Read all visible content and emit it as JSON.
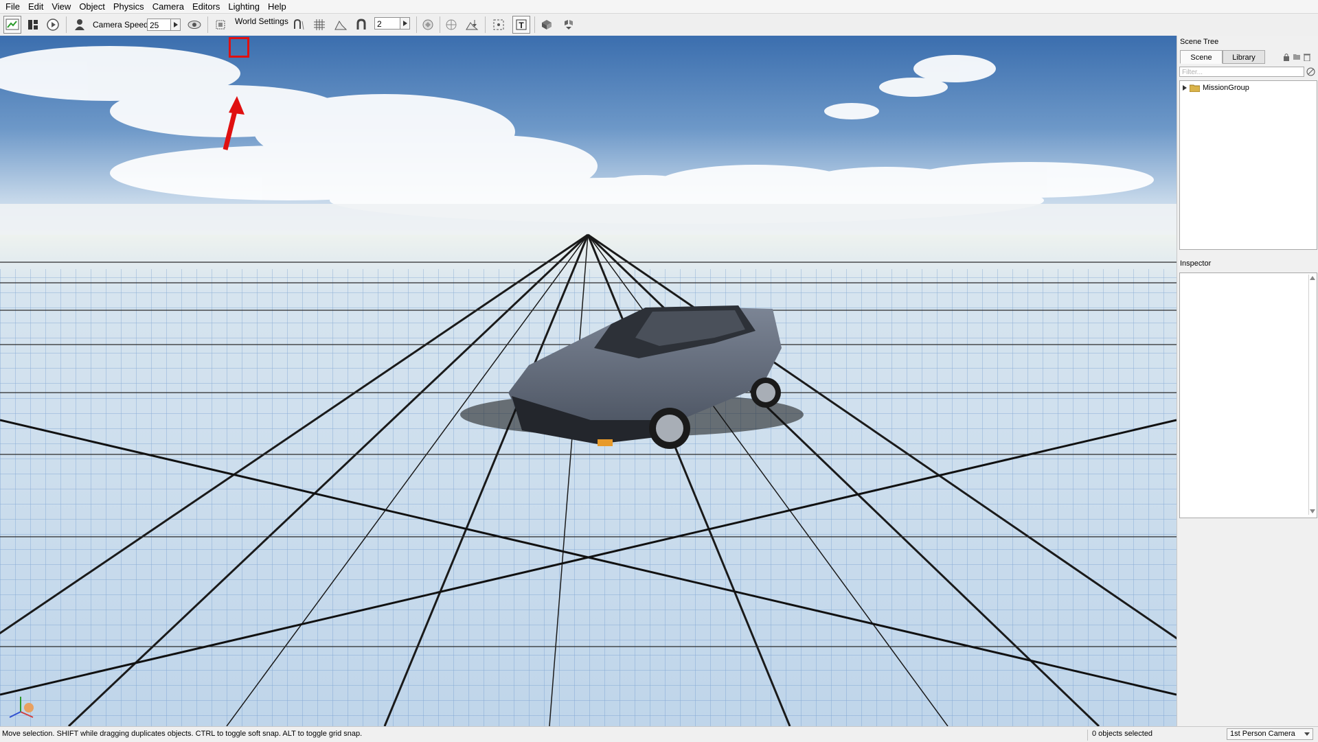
{
  "menu": [
    "File",
    "Edit",
    "View",
    "Object",
    "Physics",
    "Camera",
    "Editors",
    "Lighting",
    "Help"
  ],
  "toolbar": {
    "camera_speed_label": "Camera Speed",
    "camera_speed_value": "25",
    "world_settings_label": "World Settings",
    "grid_snap_value": "2"
  },
  "scene_tree": {
    "title": "Scene Tree",
    "tabs": [
      "Scene",
      "Library"
    ],
    "active_tab": "Scene",
    "filter_placeholder": "Filter...",
    "items": [
      {
        "label": "MissionGroup",
        "icon": "folder-icon"
      }
    ]
  },
  "inspector": {
    "title": "Inspector"
  },
  "status": {
    "message": "Move selection.  SHIFT while dragging duplicates objects.  CTRL to toggle soft snap.  ALT to toggle grid snap.",
    "selection": "0 objects selected",
    "camera_mode": "1st Person Camera"
  },
  "annotation": {
    "color": "#e01010",
    "target": "editor-tool-highlighted"
  },
  "colors": {
    "accent_red": "#e01010",
    "sky_top": "#3a6fb0",
    "grid_line": "#1a1a1a"
  }
}
